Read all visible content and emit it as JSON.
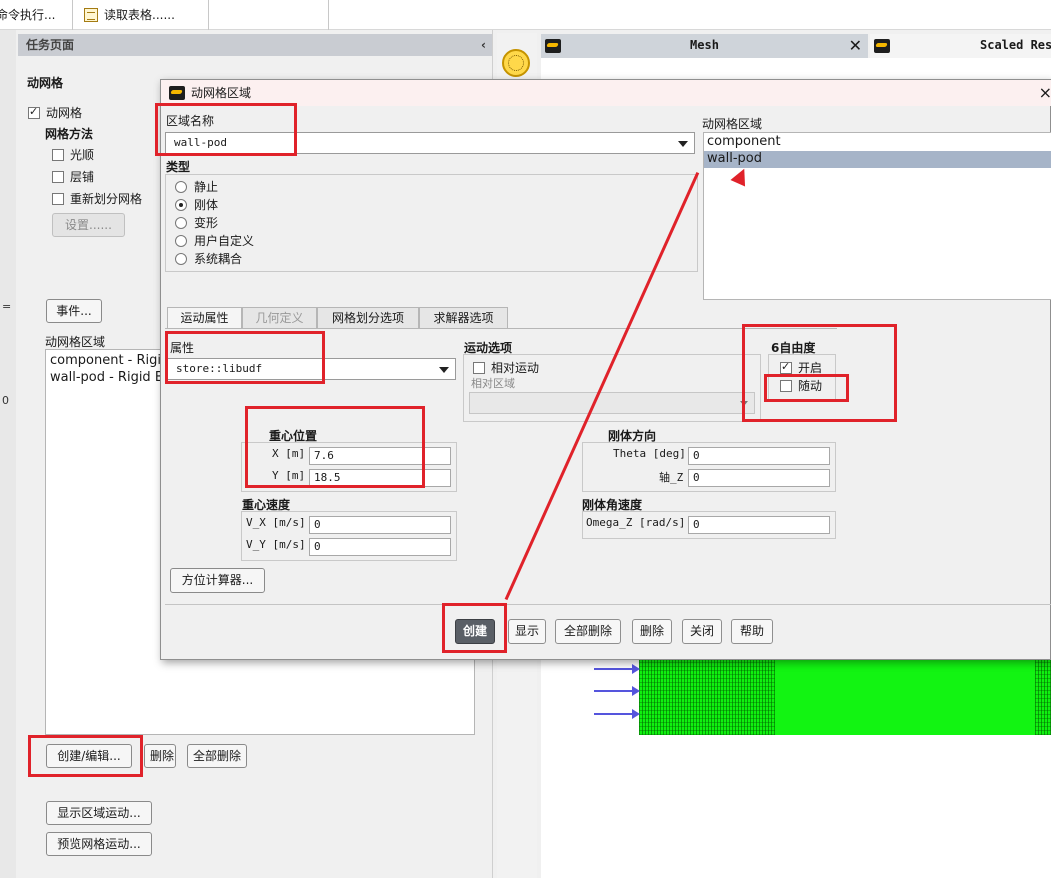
{
  "toolbar": {
    "cmd_label": "命令执行...",
    "read_table_label": "读取表格......"
  },
  "left_strip": {
    "text1": "=",
    "text2": "0"
  },
  "task_page": {
    "header": "任务页面",
    "section_title": "动网格",
    "dynamic_mesh_checkbox": "动网格",
    "mesh_method_label": "网格方法",
    "methods": [
      "光顺",
      "层铺",
      "重新划分网格"
    ],
    "settings_button": "设置......",
    "events_button": "事件...",
    "zones_label": "动网格区域",
    "zones": [
      "component - Rigid Body",
      "wall-pod - Rigid Body"
    ],
    "create_edit_button": "创建/编辑...",
    "delete_button": "删除",
    "delete_all_button": "全部删除",
    "display_zone_motion_button": "显示区域运动...",
    "preview_mesh_motion_button": "预览网格运动..."
  },
  "graphics": {
    "mesh_tab": "Mesh",
    "scaled_tab": "Scaled Res"
  },
  "dialog": {
    "title": "动网格区域",
    "zone_name_label": "区域名称",
    "zone_name_value": "wall-pod",
    "type_label": "类型",
    "types": [
      "静止",
      "刚体",
      "变形",
      "用户自定义",
      "系统耦合"
    ],
    "selected_type": "刚体",
    "zones_list_label": "动网格区域",
    "zones_list": [
      "component",
      "wall-pod"
    ],
    "selected_zone": "wall-pod",
    "tabs": [
      "运动属性",
      "几何定义",
      "网格划分选项",
      "求解器选项"
    ],
    "properties_label": "属性",
    "properties_value": "store::libudf",
    "motion_options_label": "运动选项",
    "relative_motion_label": "相对运动",
    "relative_zone_label": "相对区域",
    "dof_label": "6自由度",
    "dof_on_label": "开启",
    "dof_passive_label": "随动",
    "cg_position_label": "重心位置",
    "x_label": "X [m]",
    "x_value": "7.6",
    "y_label": "Y [m]",
    "y_value": "18.5",
    "cg_velocity_label": "重心速度",
    "vx_label": "V_X [m/s]",
    "vx_value": "0",
    "vy_label": "V_Y [m/s]",
    "vy_value": "0",
    "orientation_label": "刚体方向",
    "theta_label": "Theta [deg]",
    "theta_value": "0",
    "axis_z_label": "轴_Z",
    "axis_z_value": "0",
    "angular_velocity_label": "刚体角速度",
    "omega_label": "Omega_Z [rad/s]",
    "omega_value": "0",
    "orientation_calc_button": "方位计算器...",
    "buttons": {
      "create": "创建",
      "display": "显示",
      "delete_all": "全部删除",
      "delete": "删除",
      "close": "关闭",
      "help": "帮助"
    }
  },
  "colors": {
    "annotation_red": "#e0222a",
    "mesh_green": "#10f010",
    "selection_blue": "#a6b4c8"
  }
}
